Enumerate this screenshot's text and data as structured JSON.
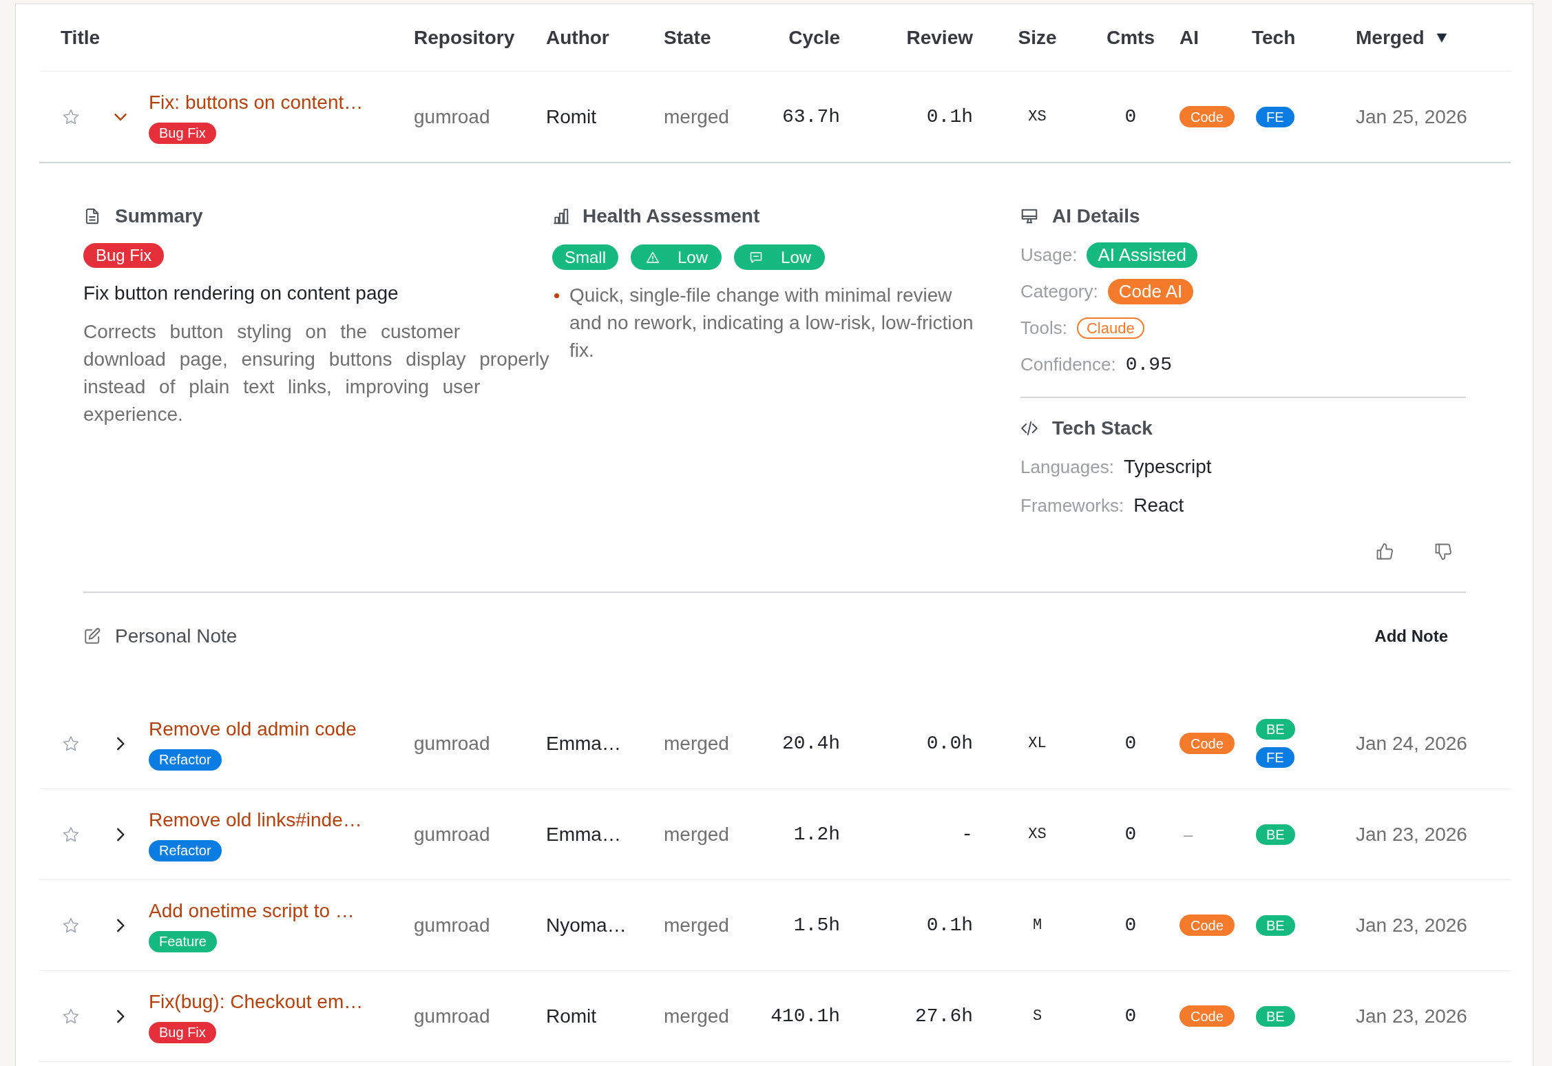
{
  "table": {
    "columns": [
      {
        "label": "Title",
        "sorted": false
      },
      {
        "label": "Repository",
        "sorted": false
      },
      {
        "label": "Author",
        "sorted": false
      },
      {
        "label": "State",
        "sorted": false
      },
      {
        "label": "Cycle",
        "sorted": false
      },
      {
        "label": "Review",
        "sorted": false
      },
      {
        "label": "Size",
        "sorted": false
      },
      {
        "label": "Cmts",
        "sorted": false
      },
      {
        "label": "AI",
        "sorted": false
      },
      {
        "label": "Tech",
        "sorted": false
      },
      {
        "label": "Merged",
        "sorted": true
      }
    ],
    "rows": [
      {
        "starred": false,
        "expanded": true,
        "title": "Fix: buttons on content…",
        "category": {
          "label": "Bug Fix",
          "color": "#e5303b"
        },
        "repository": "gumroad",
        "author": "Romit",
        "state": "merged",
        "cycle": "63.7h",
        "review": "0.1h",
        "size": "XS",
        "comments": "0",
        "ai": {
          "label": "Code",
          "color": "#f47a2c"
        },
        "tech": [
          {
            "label": "FE",
            "color": "#0b7ce2"
          }
        ],
        "merged": "Jan 25, 2026",
        "details": {
          "summary": {
            "heading": "Summary",
            "category": {
              "label": "Bug Fix",
              "color": "#e5303b"
            },
            "headline": "Fix button rendering on content page",
            "description": "Corrects button styling on the customer download page, ensuring buttons display properly instead of plain text links, improving user experience."
          },
          "health": {
            "heading": "Health Assessment",
            "indicators": [
              {
                "kind": "size",
                "label": "Small"
              },
              {
                "kind": "risk",
                "label": "Low"
              },
              {
                "kind": "review",
                "label": "Low"
              }
            ],
            "notes": [
              "Quick, single-file change with minimal review and no rework, indicating a low-risk, low-friction fix."
            ]
          },
          "ai_details": {
            "heading": "AI Details",
            "fields": [
              {
                "kind": "badge",
                "label": "Usage:",
                "value": "AI Assisted",
                "color": "#16b97f"
              },
              {
                "kind": "badge",
                "label": "Category:",
                "value": "Code AI",
                "color": "#f47a2c"
              },
              {
                "kind": "outline",
                "label": "Tools:",
                "value": "Claude",
                "color": "#f47a2c"
              },
              {
                "kind": "number",
                "label": "Confidence:",
                "value": "0.95"
              }
            ]
          },
          "tech_stack": {
            "heading": "Tech Stack",
            "fields": [
              {
                "label": "Languages:",
                "value": "Typescript"
              },
              {
                "label": "Frameworks:",
                "value": "React"
              }
            ]
          },
          "personal_note": {
            "heading": "Personal Note",
            "action": "Add Note"
          }
        }
      },
      {
        "starred": false,
        "expanded": false,
        "title": "Remove old admin code",
        "category": {
          "label": "Refactor",
          "color": "#0b7ce2"
        },
        "repository": "gumroad",
        "author": "Emma…",
        "state": "merged",
        "cycle": "20.4h",
        "review": "0.0h",
        "size": "XL",
        "comments": "0",
        "ai": {
          "label": "Code",
          "color": "#f47a2c"
        },
        "tech": [
          {
            "label": "BE",
            "color": "#16b97f"
          },
          {
            "label": "FE",
            "color": "#0b7ce2"
          }
        ],
        "merged": "Jan 24, 2026"
      },
      {
        "starred": false,
        "expanded": false,
        "title": "Remove old links#inde…",
        "category": {
          "label": "Refactor",
          "color": "#0b7ce2"
        },
        "repository": "gumroad",
        "author": "Emma…",
        "state": "merged",
        "cycle": "1.2h",
        "review": "-",
        "size": "XS",
        "comments": "0",
        "ai": {
          "label": "–"
        },
        "tech": [
          {
            "label": "BE",
            "color": "#16b97f"
          }
        ],
        "merged": "Jan 23, 2026"
      },
      {
        "starred": false,
        "expanded": false,
        "title": "Add onetime script to …",
        "category": {
          "label": "Feature",
          "color": "#16b97f"
        },
        "repository": "gumroad",
        "author": "Nyoma…",
        "state": "merged",
        "cycle": "1.5h",
        "review": "0.1h",
        "size": "M",
        "comments": "0",
        "ai": {
          "label": "Code",
          "color": "#f47a2c"
        },
        "tech": [
          {
            "label": "BE",
            "color": "#16b97f"
          }
        ],
        "merged": "Jan 23, 2026"
      },
      {
        "starred": false,
        "expanded": false,
        "title": "Fix(bug): Checkout em…",
        "category": {
          "label": "Bug Fix",
          "color": "#e5303b"
        },
        "repository": "gumroad",
        "author": "Romit",
        "state": "merged",
        "cycle": "410.1h",
        "review": "27.6h",
        "size": "S",
        "comments": "0",
        "ai": {
          "label": "Code",
          "color": "#f47a2c"
        },
        "tech": [
          {
            "label": "BE",
            "color": "#16b97f"
          }
        ],
        "merged": "Jan 23, 2026"
      }
    ]
  }
}
